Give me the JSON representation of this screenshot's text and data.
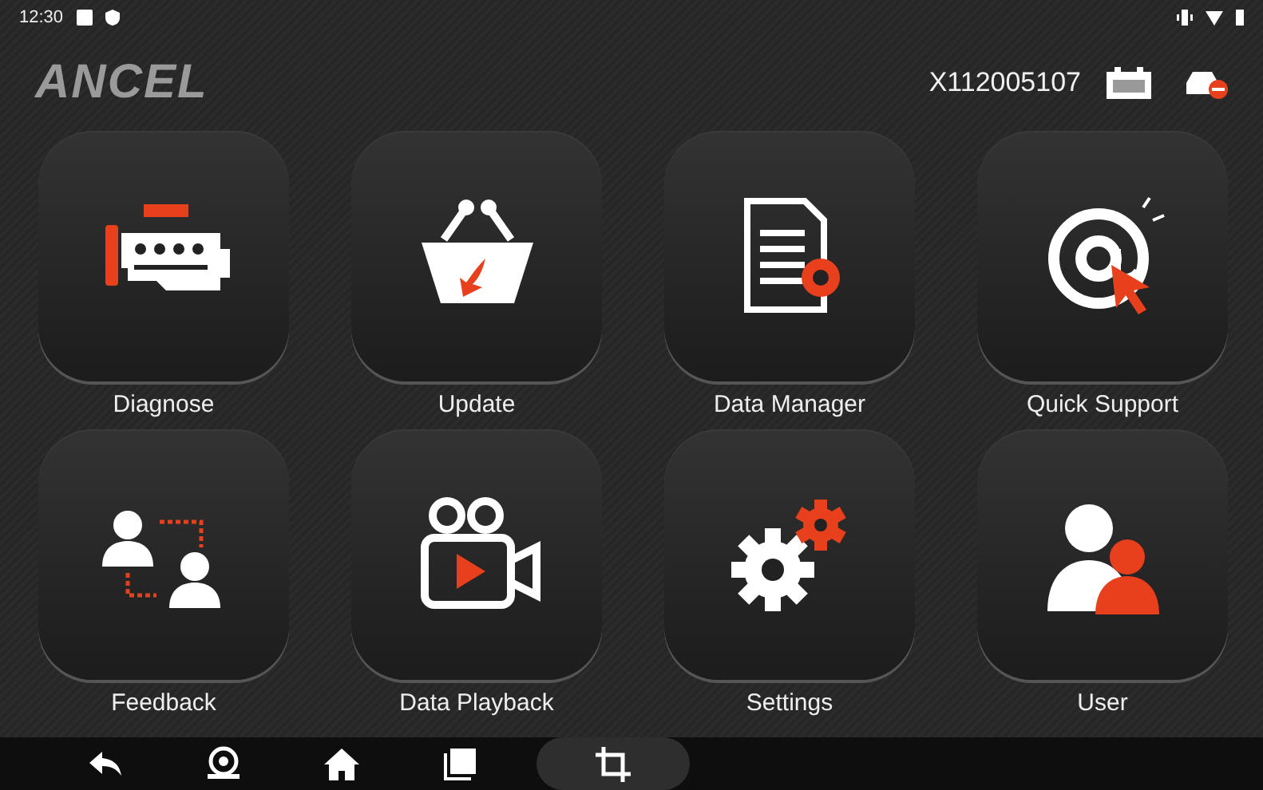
{
  "status_bar": {
    "time": "12:30"
  },
  "header": {
    "logo": "ANCEL",
    "serial": "X112005107"
  },
  "tiles": [
    {
      "kind": "diagnose",
      "label": "Diagnose"
    },
    {
      "kind": "update",
      "label": "Update"
    },
    {
      "kind": "data",
      "label": "Data Manager"
    },
    {
      "kind": "support",
      "label": "Quick Support"
    },
    {
      "kind": "feedback",
      "label": "Feedback"
    },
    {
      "kind": "playback",
      "label": "Data Playback"
    },
    {
      "kind": "settings",
      "label": "Settings"
    },
    {
      "kind": "user",
      "label": "User"
    }
  ],
  "nav_bar": [
    {
      "kind": "back",
      "selected": false
    },
    {
      "kind": "service",
      "selected": false
    },
    {
      "kind": "home",
      "selected": false
    },
    {
      "kind": "recents",
      "selected": false
    },
    {
      "kind": "crop",
      "selected": true
    }
  ]
}
